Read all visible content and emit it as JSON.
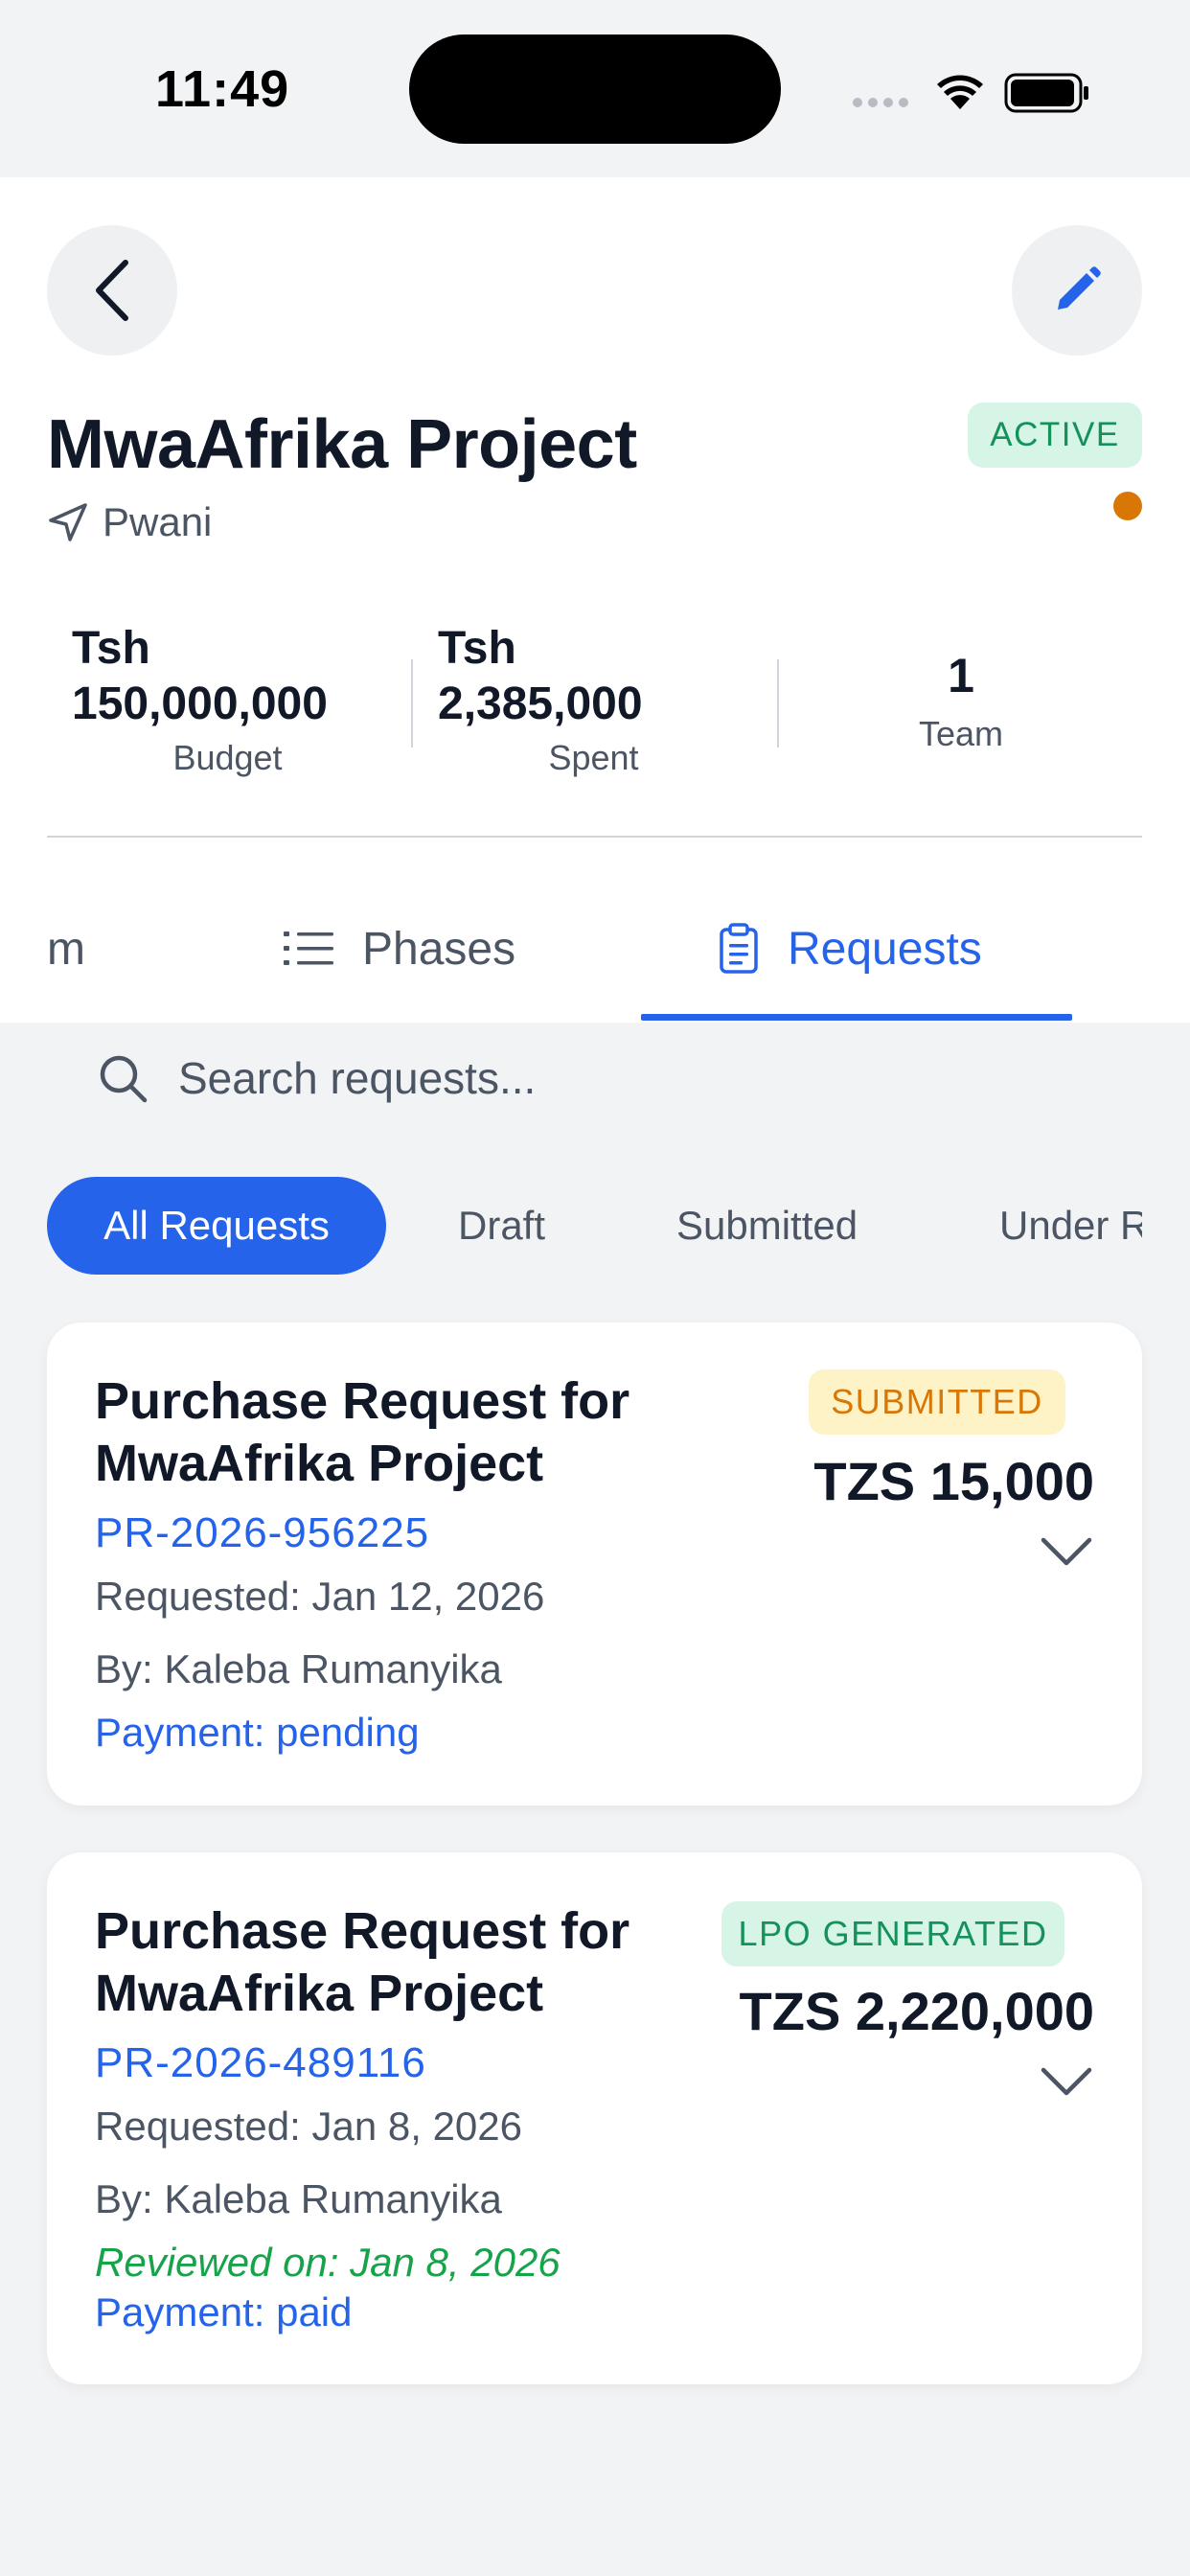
{
  "status_bar": {
    "time": "11:49"
  },
  "project": {
    "title": "MwaAfrika Project",
    "location": "Pwani",
    "status": "ACTIVE"
  },
  "stats": {
    "budget": {
      "currency": "Tsh",
      "value": "150,000,000",
      "label": "Budget"
    },
    "spent": {
      "currency": "Tsh",
      "value": "2,385,000",
      "label": "Spent"
    },
    "team": {
      "value": "1",
      "label": "Team"
    }
  },
  "tabs": [
    {
      "label": "m",
      "active": false
    },
    {
      "label": "Phases",
      "icon": "list-icon",
      "active": false
    },
    {
      "label": "Requests",
      "icon": "clipboard-icon",
      "active": true
    }
  ],
  "search": {
    "placeholder": "Search requests..."
  },
  "filters": [
    {
      "label": "All Requests",
      "active": true
    },
    {
      "label": "Draft",
      "active": false
    },
    {
      "label": "Submitted",
      "active": false
    },
    {
      "label": "Under R",
      "active": false
    }
  ],
  "requests": [
    {
      "title": "Purchase Request for MwaAfrika Project",
      "id": "PR-2026-956225",
      "status": "SUBMITTED",
      "amount": "TZS 15,000",
      "requested": "Requested: Jan 12, 2026",
      "by": "By: Kaleba Rumanyika",
      "payment": "Payment: pending"
    },
    {
      "title": "Purchase Request for MwaAfrika Project",
      "id": "PR-2026-489116",
      "status": "LPO GENERATED",
      "amount": "TZS 2,220,000",
      "requested": "Requested: Jan 8, 2026",
      "by": "By: Kaleba Rumanyika",
      "reviewed": "Reviewed on: Jan 8, 2026",
      "payment": "Payment: paid"
    }
  ],
  "colors": {
    "accent": "#2563eb",
    "active_badge_bg": "#d7f5e6",
    "active_badge_text": "#15925c",
    "submitted_badge_bg": "#fef3c7",
    "submitted_badge_text": "#d97706",
    "status_dot": "#d97706",
    "reviewed_text": "#16a34a"
  }
}
